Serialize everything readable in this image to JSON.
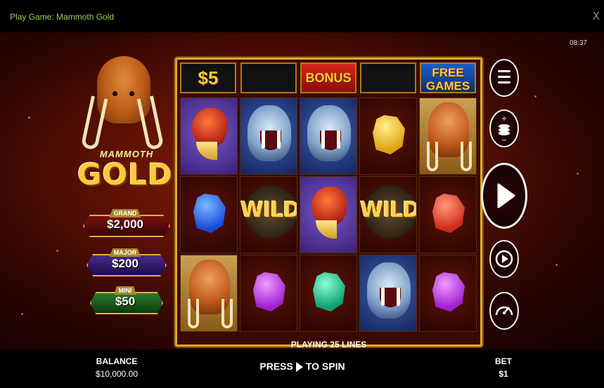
{
  "window": {
    "title": "Play Game: Mammoth Gold",
    "close_glyph": "X"
  },
  "clock": "08:37",
  "logo": {
    "line1": "MAMMOTH",
    "line2": "GOLD"
  },
  "jackpots": [
    {
      "tag": "GRAND",
      "value": "$2,000",
      "color": "#6a0a0a"
    },
    {
      "tag": "MAJOR",
      "value": "$200",
      "color": "#3a1a6a"
    },
    {
      "tag": "MINI",
      "value": "$50",
      "color": "#1a5a1a"
    }
  ],
  "top_row": {
    "prize": "$5",
    "bonus": "BONUS",
    "free_line1": "FREE",
    "free_line2": "GAMES"
  },
  "reels": [
    [
      "bird",
      "gem-blue",
      "mammoth"
    ],
    [
      "tiger",
      "wild",
      "gem-purple"
    ],
    [
      "tiger",
      "bird",
      "gem-green"
    ],
    [
      "gem-yellow",
      "wild",
      "tiger"
    ],
    [
      "mammoth",
      "gem-red",
      "gem-purple"
    ]
  ],
  "lines_text": "PLAYING 25 LINES",
  "buttons": {
    "menu": "menu-icon",
    "bet_adjust": "coin-stack-icon",
    "spin": "play-icon",
    "autoplay": "autoplay-icon",
    "turbo": "speedometer-icon"
  },
  "bottom": {
    "balance_label": "BALANCE",
    "balance_value": "$10,000.00",
    "press": "PRESS",
    "to_spin": "TO SPIN",
    "bet_label": "BET",
    "bet_value": "$1"
  }
}
